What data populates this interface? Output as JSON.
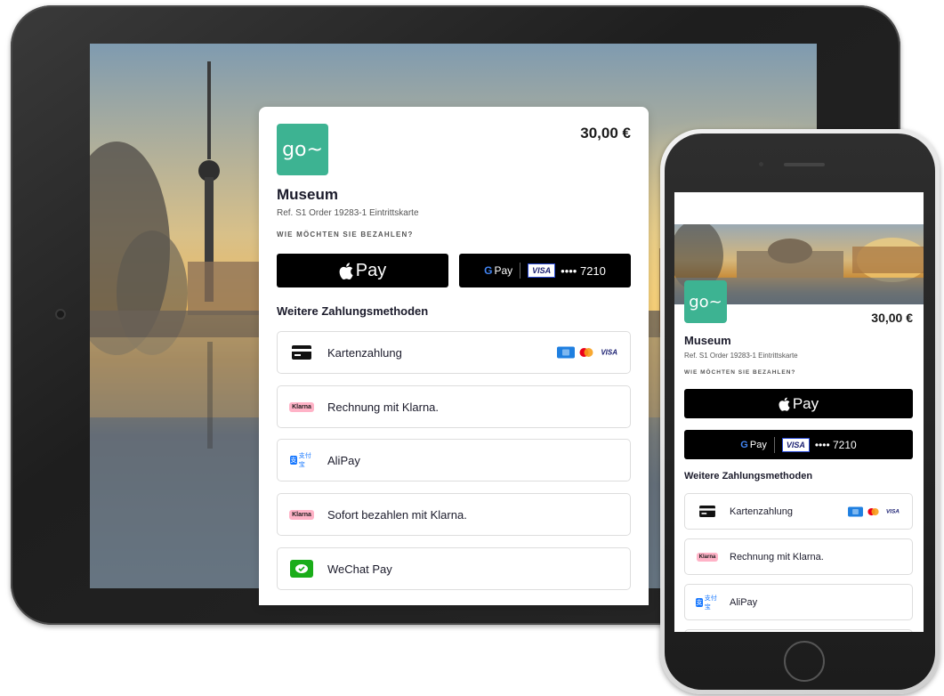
{
  "payment": {
    "logo_text": "go~",
    "amount": "30,00 €",
    "merchant": "Museum",
    "reference": "Ref. S1 Order 19283-1 Eintrittskarte",
    "question": "WIE MÖCHTEN SIE BEZAHLEN?",
    "apple_pay_label": "Pay",
    "google_pay_label": "Pay",
    "google_pay_card_brand": "VISA",
    "google_pay_card_number": "•••• 7210",
    "more_methods_title": "Weitere Zahlungsmethoden",
    "methods": [
      {
        "label": "Kartenzahlung",
        "icon": "credit-card-icon"
      },
      {
        "label": "Rechnung mit Klarna.",
        "icon": "klarna-icon",
        "badge": "Klarna"
      },
      {
        "label": "AliPay",
        "icon": "alipay-icon",
        "badge": "支付宝"
      },
      {
        "label": "Sofort bezahlen mit Klarna.",
        "icon": "klarna-icon",
        "badge": "Klarna"
      },
      {
        "label": "WeChat Pay",
        "icon": "wechat-icon"
      }
    ],
    "card_brands": [
      "amex-icon",
      "mastercard-icon",
      "visa-icon"
    ],
    "visa_small": "VISA"
  },
  "colors": {
    "brand_green": "#3db392",
    "klarna_pink": "#ffb3c7",
    "wechat_green": "#1aad19",
    "alipay_blue": "#1677ff"
  }
}
